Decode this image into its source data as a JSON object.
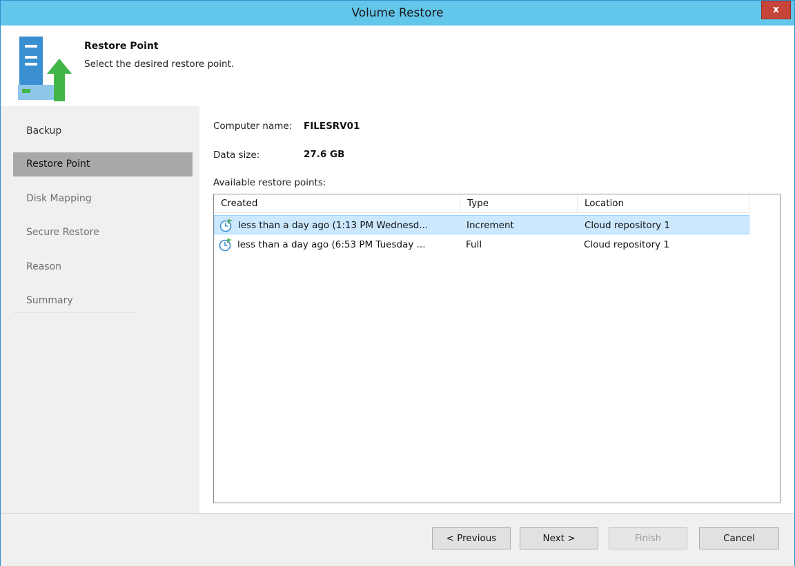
{
  "window": {
    "title": "Volume Restore",
    "close_glyph": "x"
  },
  "header": {
    "title": "Restore Point",
    "subtitle": "Select the desired restore point.",
    "icon": "server-restore-icon"
  },
  "sidebar": {
    "items": [
      {
        "label": "Backup",
        "state": "done"
      },
      {
        "label": "Restore Point",
        "state": "selected"
      },
      {
        "label": "Disk Mapping",
        "state": "inactive"
      },
      {
        "label": "Secure Restore",
        "state": "inactive"
      },
      {
        "label": "Reason",
        "state": "inactive"
      },
      {
        "label": "Summary",
        "state": "inactive"
      }
    ]
  },
  "main": {
    "computer_name_label": "Computer name:",
    "computer_name_value": "FILESRV01",
    "data_size_label": "Data size:",
    "data_size_value": "27.6 GB",
    "list_label": "Available restore points:",
    "columns": [
      "Created",
      "Type",
      "Location"
    ],
    "rows": [
      {
        "created": "less than a day ago (1:13 PM Wednesd...",
        "type": "Increment",
        "location": "Cloud repository 1",
        "selected": true,
        "icon": "restore-point-clock-icon"
      },
      {
        "created": "less than a day ago (6:53 PM Tuesday ...",
        "type": "Full",
        "location": "Cloud repository 1",
        "selected": false,
        "icon": "restore-point-clock-icon"
      }
    ]
  },
  "footer": {
    "previous_label": "< Previous",
    "next_label": "Next >",
    "finish_label": "Finish",
    "cancel_label": "Cancel"
  },
  "colors": {
    "titlebar": "#63c6eb",
    "close_button": "#c7443a",
    "selection": "#cce8ff",
    "nav_selected": "#a9a9a9",
    "icon_green": "#43b649"
  }
}
